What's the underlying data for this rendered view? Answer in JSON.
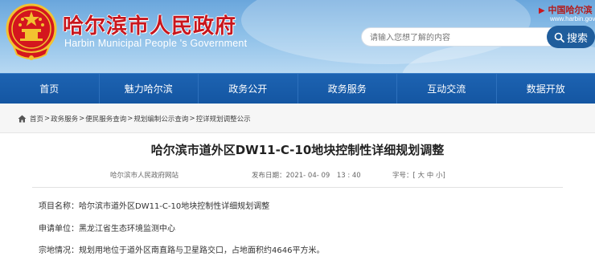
{
  "header": {
    "title": "哈尔滨市人民政府",
    "subtitle": "Harbin Municipal People 's Government",
    "brand_logo": "中国哈尔滨",
    "brand_url": "www.harbin.gov.cn",
    "search_placeholder": "请输入您想了解的内容",
    "search_button": "搜索",
    "title_color": "#c8161d",
    "accent_color": "#1f5d9c"
  },
  "nav": {
    "items": [
      "首页",
      "魅力哈尔滨",
      "政务公开",
      "政务服务",
      "互动交流",
      "数据开放"
    ]
  },
  "breadcrumb": {
    "items": [
      "首页",
      "政务服务",
      "便民服务查询",
      "规划编制公示查询",
      "控详规划调整公示"
    ],
    "separator": ">"
  },
  "article": {
    "title": "哈尔滨市道外区DW11-C-10地块控制性详细规划调整",
    "source": "哈尔滨市人民政府网站",
    "date_label": "发布日期：",
    "date_value": "2021- 04- 09　13 : 40",
    "font_label": "字号：",
    "font_open": "[",
    "font_large": "大",
    "font_medium": "中",
    "font_small": "小",
    "font_close": "]",
    "fields": [
      {
        "label": "项目名称：",
        "value": "哈尔滨市道外区DW11-C-10地块控制性详细规划调整"
      },
      {
        "label": "申请单位：",
        "value": "黑龙江省生态环境监测中心"
      },
      {
        "label": "宗地情况：",
        "value": "规划用地位于道外区南直路与卫星路交口，占地面积约4646平方米。"
      }
    ]
  }
}
